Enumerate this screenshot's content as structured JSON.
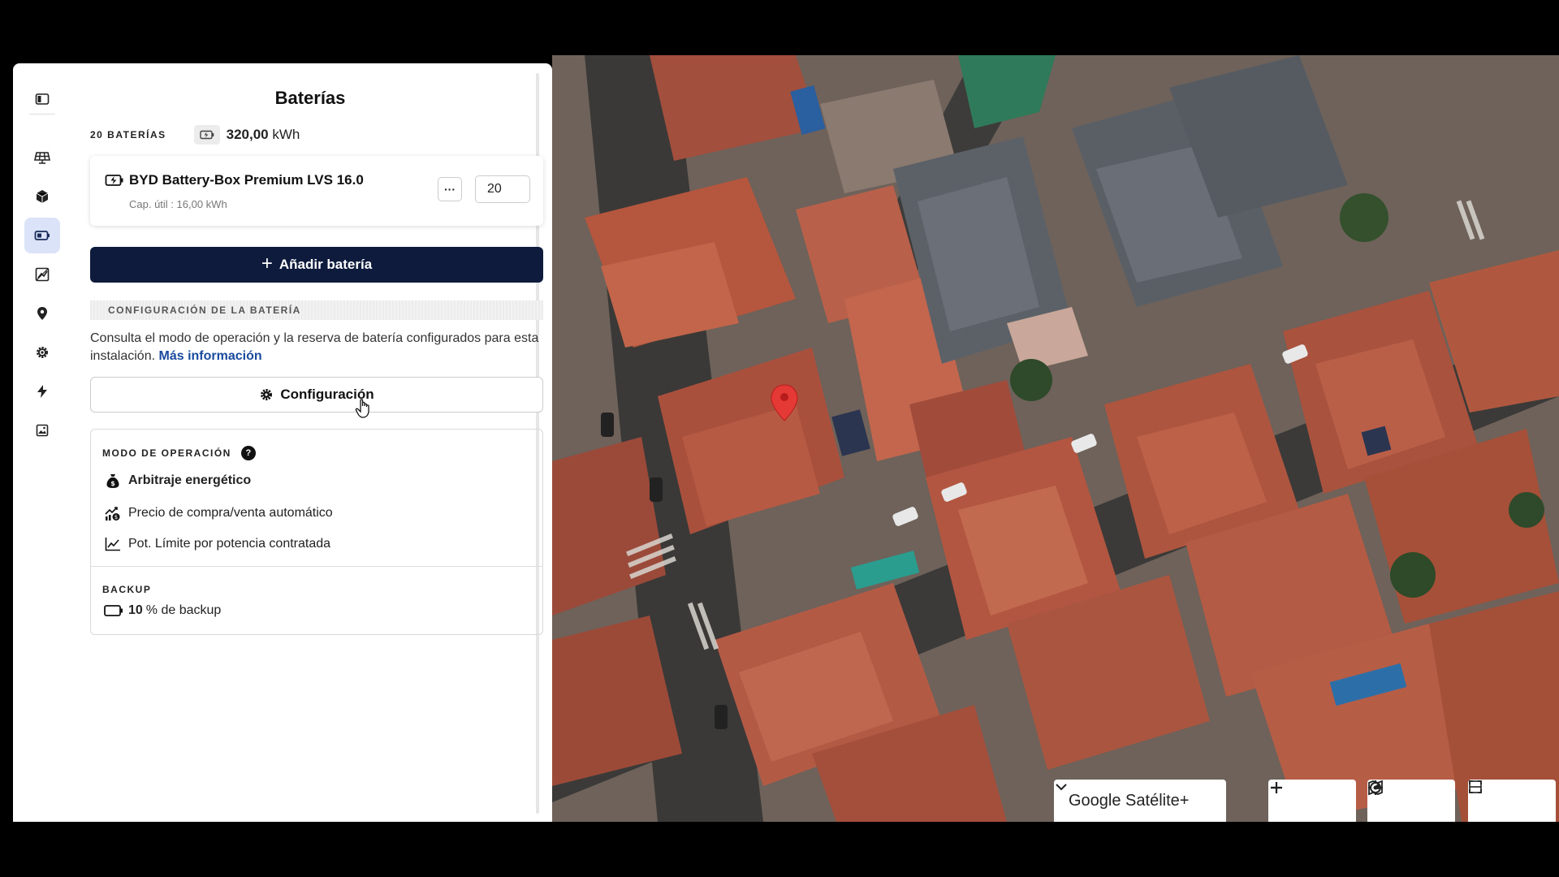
{
  "panel": {
    "title": "Baterías",
    "battery_count": "20 BATERÍAS",
    "total_capacity_value": "320,00",
    "total_capacity_unit": "kWh"
  },
  "battery": {
    "name": "BYD Battery-Box Premium LVS 16.0",
    "capacity": "Cap. útil : 16,00 kWh",
    "quantity": "20",
    "more_label": "···"
  },
  "actions": {
    "add_battery": "Añadir batería",
    "configuration": "Configuración"
  },
  "config_section": {
    "heading": "CONFIGURACIÓN DE LA BATERÍA",
    "description": "Consulta el modo de operación y la reserva de batería configurados para esta instalación.",
    "more_info": "Más información"
  },
  "operation_mode": {
    "label": "MODO DE OPERACIÓN",
    "help": "?",
    "items": [
      {
        "text": "Arbitraje energético"
      },
      {
        "text": "Precio de compra/venta automático"
      },
      {
        "text": "Pot. Límite por potencia contratada"
      }
    ]
  },
  "backup": {
    "label": "BACKUP",
    "value": "10",
    "suffix": "% de backup"
  },
  "map": {
    "layer_select": "Google Satélite+"
  },
  "icons": {
    "rail": [
      "sidebar-toggle-icon",
      "solar-panel-icon",
      "cube-icon",
      "battery-icon",
      "consumption-icon",
      "location-pin-icon",
      "gear-icon",
      "bolt-icon",
      "image-icon"
    ]
  },
  "colors": {
    "primary_dark": "#0e1b3d",
    "link": "#1a4a9e",
    "active_rail": "#dbe3f8",
    "marker": "#e53935"
  }
}
